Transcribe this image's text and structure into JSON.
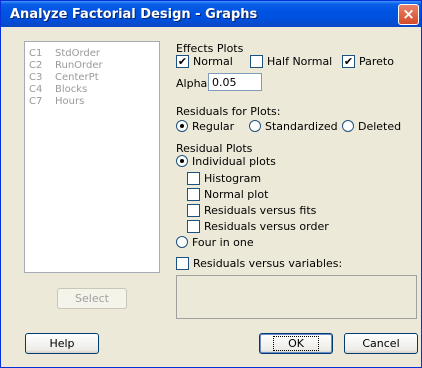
{
  "window": {
    "title": "Analyze Factorial Design - Graphs",
    "close": "×"
  },
  "variables": [
    {
      "id": "C1",
      "name": "StdOrder"
    },
    {
      "id": "C2",
      "name": "RunOrder"
    },
    {
      "id": "C3",
      "name": "CenterPt"
    },
    {
      "id": "C4",
      "name": "Blocks"
    },
    {
      "id": "C7",
      "name": "Hours"
    }
  ],
  "effects_plots": {
    "label": "Effects Plots",
    "normal": {
      "label": "Normal",
      "checked": true
    },
    "half_normal": {
      "label": "Half Normal",
      "checked": false
    },
    "pareto": {
      "label": "Pareto",
      "checked": true
    }
  },
  "alpha": {
    "label": "Alpha:",
    "value": "0.05"
  },
  "residuals_for_plots": {
    "label": "Residuals for Plots:",
    "options": [
      "Regular",
      "Standardized",
      "Deleted"
    ],
    "selected": "Regular"
  },
  "residual_plots": {
    "label": "Residual Plots",
    "individual": "Individual plots",
    "histogram": "Histogram",
    "normal_plot": "Normal plot",
    "vs_fits": "Residuals versus fits",
    "vs_order": "Residuals versus order",
    "four_in_one": "Four in one",
    "vs_variables": "Residuals versus variables:"
  },
  "buttons": {
    "select": "Select",
    "help": "Help",
    "ok": "OK",
    "cancel": "Cancel"
  },
  "check_mark": "✔"
}
